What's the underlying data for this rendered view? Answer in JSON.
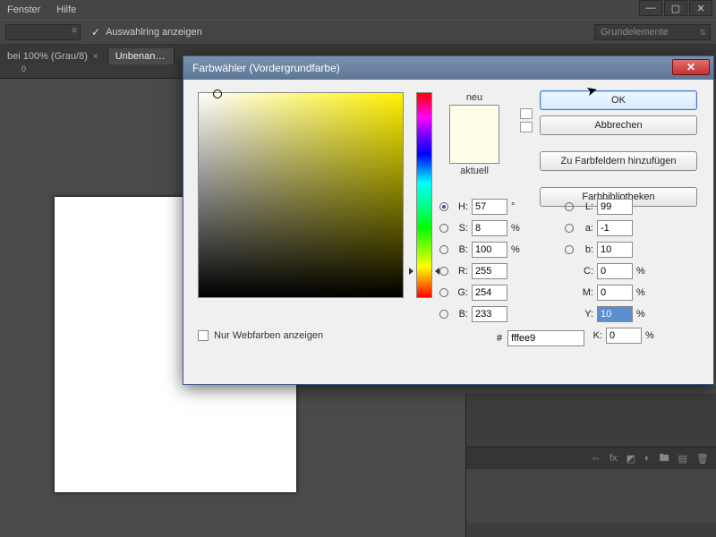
{
  "menu": {
    "fenster": "Fenster",
    "hilfe": "Hilfe"
  },
  "toolbar": {
    "auswahlring": "Auswahlring anzeigen",
    "workspace": "Grundelemente"
  },
  "tabs": {
    "t1": "bei 100% (Grau/8)",
    "t2": "Unbenan…"
  },
  "ruler_zero": "0",
  "dialog": {
    "title": "Farbwähler (Vordergrundfarbe)",
    "neu": "neu",
    "aktuell": "aktuell",
    "ok": "OK",
    "cancel": "Abbrechen",
    "addSwatch": "Zu Farbfeldern hinzufügen",
    "libs": "Farbbibliotheken",
    "webonly": "Nur Webfarben anzeigen",
    "hash": "#",
    "hex": "fffee9",
    "labels": {
      "H": "H:",
      "S": "S:",
      "Bv": "B:",
      "R": "R:",
      "G": "G:",
      "Bb": "B:",
      "L": "L:",
      "a": "a:",
      "b": "b:",
      "C": "C:",
      "M": "M:",
      "Y": "Y:",
      "K": "K:"
    },
    "vals": {
      "H": "57",
      "S": "8",
      "Bv": "100",
      "R": "255",
      "G": "254",
      "Bb": "233",
      "L": "99",
      "a": "-1",
      "b": "10",
      "C": "0",
      "M": "0",
      "Y": "10",
      "K": "0"
    },
    "units": {
      "deg": "°",
      "pct": "%"
    }
  },
  "layer_icons": {
    "link": "⇔",
    "fx": "fx",
    "mask": "◩",
    "adj": "◐",
    "folder": "🖿",
    "new": "▤",
    "trash": "🗑"
  }
}
